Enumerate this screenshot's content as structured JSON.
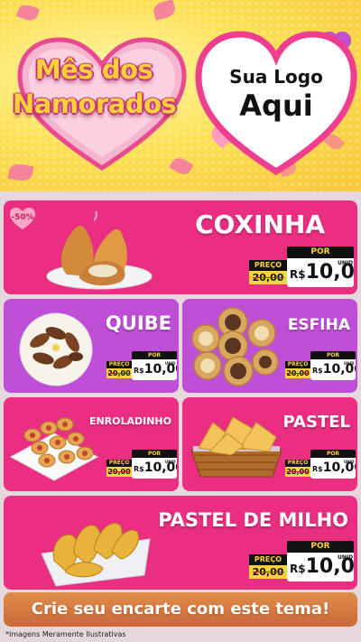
{
  "header": {
    "title_line1": "Mês dos",
    "title_line2": "Namorados",
    "logo_line1": "Sua Logo",
    "logo_line2": "Aqui"
  },
  "colors": {
    "pink": "#ea2f82",
    "purple": "#c04fd7",
    "yellow": "#ffd23a",
    "cta": "#d9773f"
  },
  "products": [
    {
      "name": "COXINHA",
      "badge": "-50%",
      "por": "POR",
      "preco": "PREÇO",
      "old_price": "20,00",
      "currency": "R$",
      "price": "10,00",
      "unit": "UNID",
      "image": "coxinha-image"
    },
    {
      "name": "QUIBE",
      "por": "POR",
      "preco": "PREÇO",
      "old_price": "20,00",
      "currency": "R$",
      "price": "10,00",
      "unit": "UNID",
      "image": "quibe-image"
    },
    {
      "name": "ESFIHA",
      "por": "POR",
      "preco": "PREÇO",
      "old_price": "20,00",
      "currency": "R$",
      "price": "10,00",
      "unit": "UNID",
      "image": "esfiha-image"
    },
    {
      "name": "ENROLADINHO",
      "por": "POR",
      "preco": "PREÇO",
      "old_price": "20,00",
      "currency": "R$",
      "price": "10,00",
      "unit": "UNID",
      "image": "enroladinho-image"
    },
    {
      "name": "PASTEL",
      "por": "POR",
      "preco": "PREÇO",
      "old_price": "20,00",
      "currency": "R$",
      "price": "10,00",
      "unit": "UNID",
      "image": "pastel-image"
    },
    {
      "name": "PASTEL DE MILHO",
      "por": "POR",
      "preco": "PREÇO",
      "old_price": "20,00",
      "currency": "R$",
      "price": "10,00",
      "unit": "UNID",
      "image": "pastel-de-milho-image"
    }
  ],
  "cta": {
    "label": "Crie seu encarte com este tema!"
  },
  "footnote": "*Imagens Meramente Ilustrativas"
}
